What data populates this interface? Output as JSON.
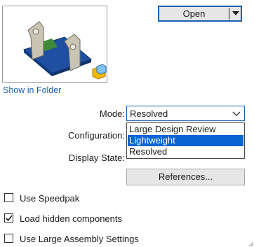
{
  "preview": {
    "alt_icon": "assembly-preview-icon",
    "badge_icon": "assembly-badge-icon"
  },
  "show_in_folder": "Show in Folder",
  "open_button": {
    "label": "Open"
  },
  "mode": {
    "label": "Mode:",
    "value": "Resolved",
    "options": [
      {
        "label": "Large Design Review",
        "selected": false
      },
      {
        "label": "Lightweight",
        "selected": true
      },
      {
        "label": "Resolved",
        "selected": false
      }
    ]
  },
  "configuration": {
    "label": "Configuration:"
  },
  "display_state": {
    "label": "Display State:"
  },
  "references_button": {
    "label": "References..."
  },
  "checkboxes": [
    {
      "label": "Use Speedpak",
      "checked": false
    },
    {
      "label": "Load hidden components",
      "checked": true
    },
    {
      "label": "Use Large Assembly Settings",
      "checked": false
    }
  ],
  "colors": {
    "accent": "#1a5fb4",
    "selection": "#0a64d2"
  }
}
